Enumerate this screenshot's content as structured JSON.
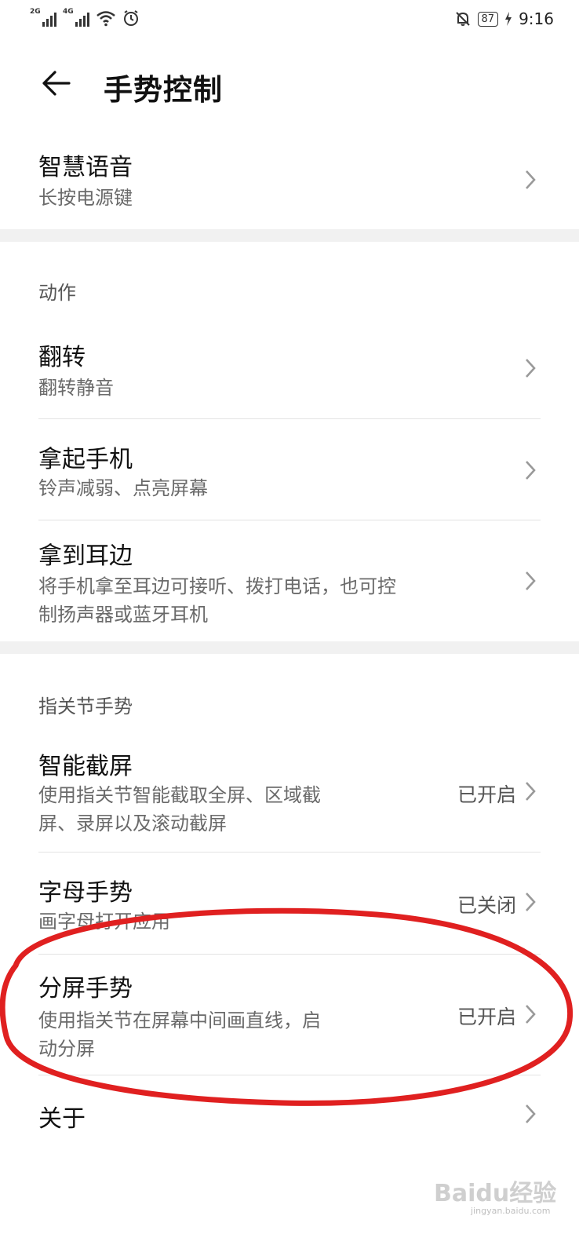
{
  "status_bar": {
    "sim1": "2G",
    "sim2": "4G",
    "battery": "87",
    "time": "9:16"
  },
  "header": {
    "title": "手势控制"
  },
  "rows": {
    "voice": {
      "title": "智慧语音",
      "subtitle": "长按电源键"
    },
    "flip": {
      "title": "翻转",
      "subtitle": "翻转静音"
    },
    "pickup": {
      "title": "拿起手机",
      "subtitle": "铃声减弱、点亮屏幕"
    },
    "ear": {
      "title": "拿到耳边",
      "subtitle_line1": "将手机拿至耳边可接听、拨打电话，也可控",
      "subtitle_line2": "制扬声器或蓝牙耳机"
    },
    "screenshot": {
      "title": "智能截屏",
      "subtitle_line1": "使用指关节智能截取全屏、区域截",
      "subtitle_line2": "屏、录屏以及滚动截屏",
      "value": "已开启"
    },
    "letter": {
      "title": "字母手势",
      "subtitle": "画字母打开应用",
      "value": "已关闭"
    },
    "split": {
      "title": "分屏手势",
      "subtitle_line1": "使用指关节在屏幕中间画直线，启",
      "subtitle_line2": "动分屏",
      "value": "已开启"
    },
    "about": {
      "title": "关于"
    }
  },
  "sections": {
    "action": "动作",
    "knuckle": "指关节手势"
  },
  "annotation": {
    "ellipse_color": "#e02020"
  },
  "watermark": {
    "brand": "Baidu经验",
    "url": "jingyan.baidu.com"
  }
}
